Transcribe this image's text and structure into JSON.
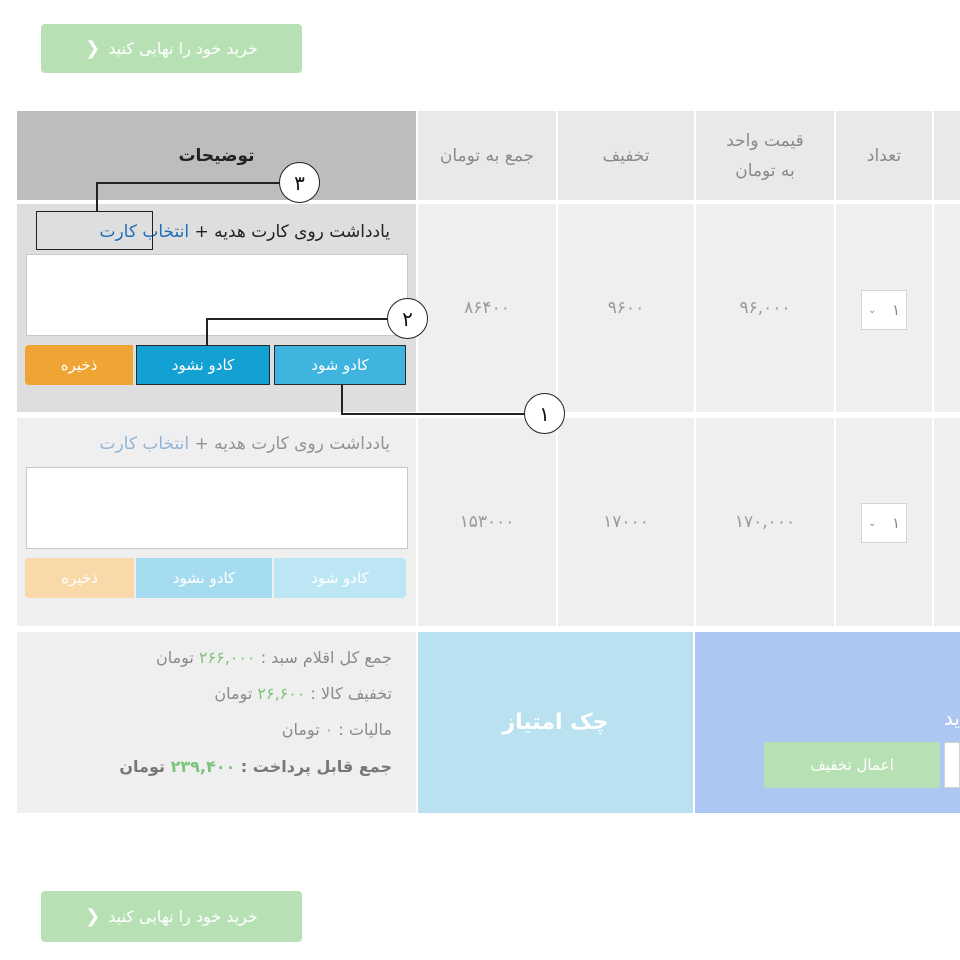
{
  "finalize_top": {
    "label": "خرید خود را نهایی کنید",
    "icon": "chevron-left-icon"
  },
  "finalize_bottom": {
    "label": "خرید خود را نهایی کنید",
    "icon": "chevron-left-icon"
  },
  "table": {
    "headers": {
      "description": "توضیحات",
      "total": "جمع به تومان",
      "discount": "تخفیف",
      "unit_price": "قیمت واحد به تومان",
      "quantity": "تعداد"
    },
    "rows": [
      {
        "note_label": "یادداشت روی کارت هدیه + ",
        "note_link": "انتخاب کارت",
        "gift_label": "کادو شود",
        "no_gift_label": "کادو نشود",
        "save_label": "ذخیره",
        "total": "۸۶۴۰۰",
        "discount": "۹۶۰۰",
        "unit_price": "۹۶,۰۰۰",
        "quantity": "۱"
      },
      {
        "note_label": "یادداشت روی کارت هدیه + ",
        "note_link": "انتخاب کارت",
        "gift_label": "کادو شود",
        "no_gift_label": "کادو نشود",
        "save_label": "ذخیره",
        "total": "۱۵۳۰۰۰",
        "discount": "۱۷۰۰۰",
        "unit_price": "۱۷۰,۰۰۰",
        "quantity": "۱"
      }
    ]
  },
  "summary": {
    "items_total_label": "جمع کل اقلام سبد : ",
    "items_total_value": "۲۶۶,۰۰۰",
    "goods_discount_label": "تخفیف کالا : ",
    "goods_discount_value": "۲۶,۶۰۰",
    "tax_label": "مالیات : ",
    "tax_value": "۰",
    "payable_label": "جمع قابل پرداخت : ",
    "payable_value": "۲۳۹,۴۰۰",
    "currency": "تومان"
  },
  "gift_check": {
    "label": "چک امتیاز"
  },
  "discount_panel": {
    "partial_text": "ید",
    "apply_label": "اعمال تخفیف"
  },
  "callouts": [
    "۱",
    "۲",
    "۳"
  ],
  "colors": {
    "finalize": "#b8e0b5",
    "gift_blue": "#3fb4df",
    "no_gift_blue": "#13a0d2",
    "save_orange": "#f0a433",
    "check_panel": "#b9e1f0",
    "discount_panel": "#aec6f2",
    "link": "#1f6fb8",
    "amount_green": "#7bc47a"
  }
}
